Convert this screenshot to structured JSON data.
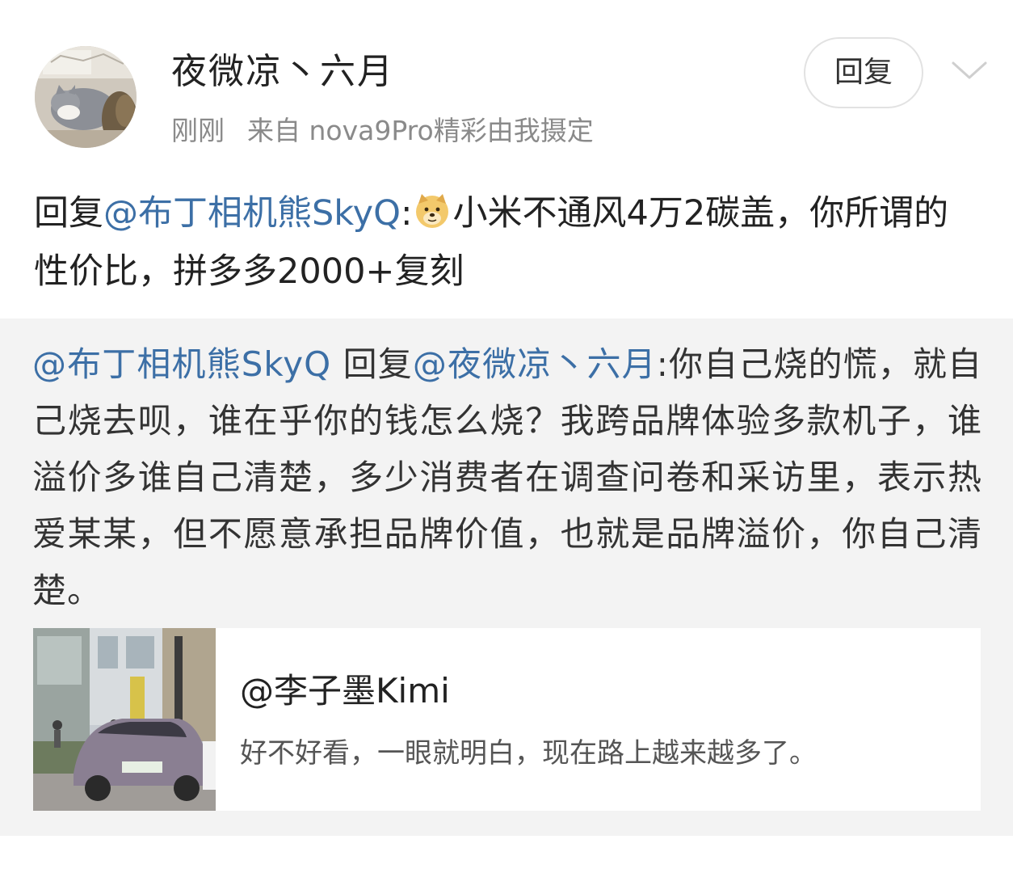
{
  "post": {
    "username": "夜微凉丶六月",
    "time": "刚刚",
    "source": "来自 nova9Pro精彩由我摄定",
    "reply_button": "回复",
    "avatar_icon": "cat-avatar-icon",
    "menu_icon": "chevron-down-icon",
    "text_prefix": "回复",
    "mention": "@布丁相机熊SkyQ",
    "colon": ":",
    "emoji": "doge-emoji-icon",
    "text_body": "小米不通风4万2碳盖，你所谓的性价比，拼多多2000+复刻"
  },
  "quoted": {
    "author_mention": "@布丁相机熊SkyQ",
    "reply_word": " 回复",
    "reply_mention": "@夜微凉丶六月",
    "text": ":你自己烧的慌，就自己烧去呗，谁在乎你的钱怎么烧？我跨品牌体验多款机子，谁溢价多谁自己清楚，多少消费者在调查问卷和采访里，表示热爱某某，但不愿意承担品牌价值，也就是品牌溢价，你自己清楚。",
    "card": {
      "title": "@李子墨Kimi",
      "description": "好不好看，一眼就明白，现在路上越来越多了。",
      "image": "street-car-photo"
    }
  },
  "colors": {
    "link": "#3c6fa6",
    "quote_bg": "#f3f3f3",
    "meta_text": "#8a8a8a"
  }
}
